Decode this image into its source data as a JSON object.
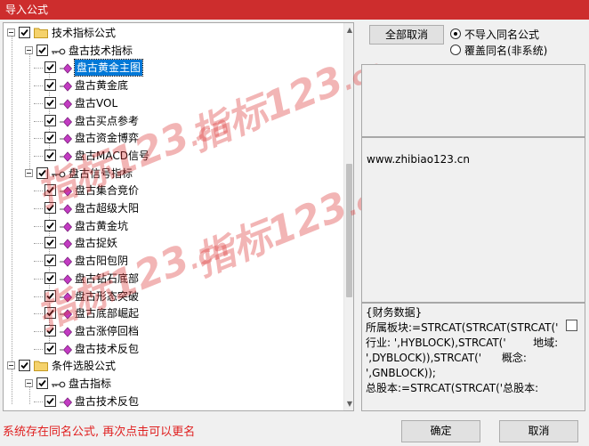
{
  "window": {
    "title": "导入公式"
  },
  "tree": [
    {
      "label": "技术指标公式",
      "kind": "folder"
    },
    {
      "label": "盘古技术指标",
      "kind": "group"
    },
    {
      "label": "盘古黄金主图",
      "kind": "item",
      "selected": true
    },
    {
      "label": "盘古黄金底",
      "kind": "item"
    },
    {
      "label": "盘古VOL",
      "kind": "item"
    },
    {
      "label": "盘古买点参考",
      "kind": "item"
    },
    {
      "label": "盘古资金博弈",
      "kind": "item"
    },
    {
      "label": "盘古MACD信号",
      "kind": "item"
    },
    {
      "label": "盘古信号指标",
      "kind": "group"
    },
    {
      "label": "盘古集合竞价",
      "kind": "item"
    },
    {
      "label": "盘古超级大阳",
      "kind": "item"
    },
    {
      "label": "盘古黄金坑",
      "kind": "item"
    },
    {
      "label": "盘古捉妖",
      "kind": "item"
    },
    {
      "label": "盘古阳包阴",
      "kind": "item"
    },
    {
      "label": "盘古钻石底部",
      "kind": "item"
    },
    {
      "label": "盘古形态突破",
      "kind": "item"
    },
    {
      "label": "盘古底部崛起",
      "kind": "item"
    },
    {
      "label": "盘古涨停回档",
      "kind": "item"
    },
    {
      "label": "盘古技术反包",
      "kind": "item"
    },
    {
      "label": "条件选股公式",
      "kind": "folder"
    },
    {
      "label": "盘古指标",
      "kind": "group"
    },
    {
      "label": "盘古技术反包",
      "kind": "item"
    }
  ],
  "buttons": {
    "cancel_all": "全部取消",
    "ok": "确定",
    "cancel": "取消"
  },
  "options": {
    "no_import": "不导入同名公式",
    "overwrite": "覆盖同名(非系统)"
  },
  "info": {
    "url": "www.zhibiao123.cn"
  },
  "formula": {
    "lines": [
      "{财务数据}",
      "所属板块:=STRCAT(STRCAT(STRCAT('",
      "行业: ',HYBLOCK),STRCAT('        地域:",
      "',DYBLOCK)),STRCAT('      概念:",
      "',GNBLOCK));",
      "总股本:=STRCAT(STRCAT('总股本:"
    ]
  },
  "watermark": {
    "text": "指标123",
    "suffix": ".cn"
  },
  "footer": {
    "message": "系统存在同名公式, 再次点击可以更名"
  },
  "colors": {
    "titlebar": "#cd2d2d",
    "selection": "#0078d7",
    "error_text": "#e02020"
  }
}
